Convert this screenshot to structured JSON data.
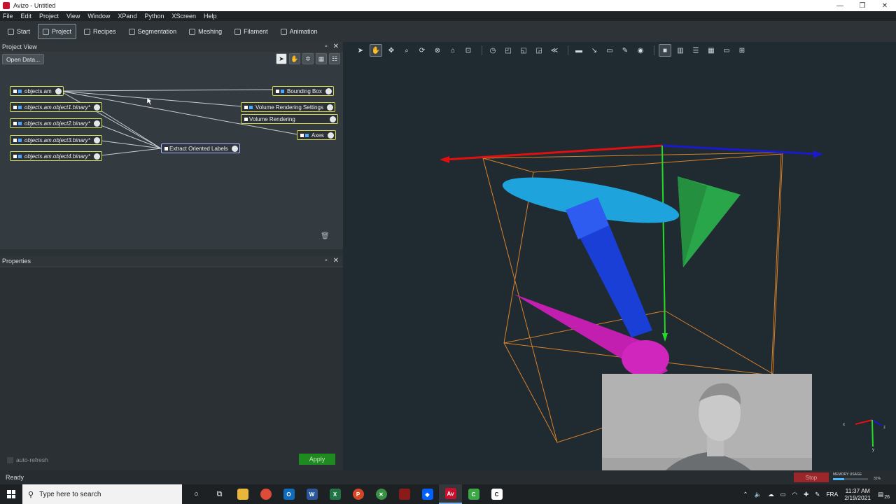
{
  "window": {
    "title": "Avizo - Untitled",
    "controls": [
      "—",
      "❐",
      "✕"
    ]
  },
  "menu": [
    "File",
    "Edit",
    "Project",
    "View",
    "Window",
    "XPand",
    "Python",
    "XScreen",
    "Help"
  ],
  "workrooms": [
    {
      "label": "Start",
      "icon": "start-icon"
    },
    {
      "label": "Project",
      "icon": "project-icon",
      "active": true
    },
    {
      "label": "Recipes",
      "icon": "recipes-icon"
    },
    {
      "label": "Segmentation",
      "icon": "segmentation-icon"
    },
    {
      "label": "Meshing",
      "icon": "meshing-icon"
    },
    {
      "label": "Filament",
      "icon": "filament-icon"
    },
    {
      "label": "Animation",
      "icon": "animation-icon"
    }
  ],
  "project_view": {
    "title": "Project View",
    "open_data": "Open Data...",
    "nodes": [
      {
        "label": "objects.am",
        "kind": "data"
      },
      {
        "label": "objects.am.object1.binary*",
        "kind": "data"
      },
      {
        "label": "objects.am.object2.binary*",
        "kind": "data"
      },
      {
        "label": "objects.am.object3.binary*",
        "kind": "data"
      },
      {
        "label": "objects.am.object4.binary*",
        "kind": "data"
      },
      {
        "label": "Extract Oriented Labels",
        "kind": "compute"
      },
      {
        "label": "Bounding Box",
        "kind": "display"
      },
      {
        "label": "Volume Rendering Settings",
        "kind": "display"
      },
      {
        "label": "Volume Rendering",
        "kind": "display"
      },
      {
        "label": "Axes",
        "kind": "display"
      }
    ]
  },
  "properties": {
    "title": "Properties",
    "auto_refresh": "auto-refresh",
    "apply": "Apply"
  },
  "viewer": {
    "axis_colors": {
      "x": "#e01010",
      "y": "#22dd22",
      "z": "#1a1acc"
    },
    "bbox_color": "#d9822b",
    "objects": [
      {
        "shape": "ellipsoid",
        "color": "#1fa3dd"
      },
      {
        "shape": "box",
        "color": "#1a3fd6"
      },
      {
        "shape": "pyramid",
        "color": "#2aa64a"
      },
      {
        "shape": "cone",
        "color": "#c21fb0"
      }
    ],
    "orient_labels": {
      "x": "x",
      "y": "y",
      "z": "z"
    }
  },
  "status": {
    "text": "Ready",
    "stop": "Stop",
    "memory_label": "MEMORY USAGE",
    "memory_fraction": 0.31,
    "memory_value": "31%"
  },
  "taskbar": {
    "search_placeholder": "Type here to search",
    "language": "FRA",
    "time": "11:37 AM",
    "date": "2/19/2021",
    "notification_count": "26"
  }
}
